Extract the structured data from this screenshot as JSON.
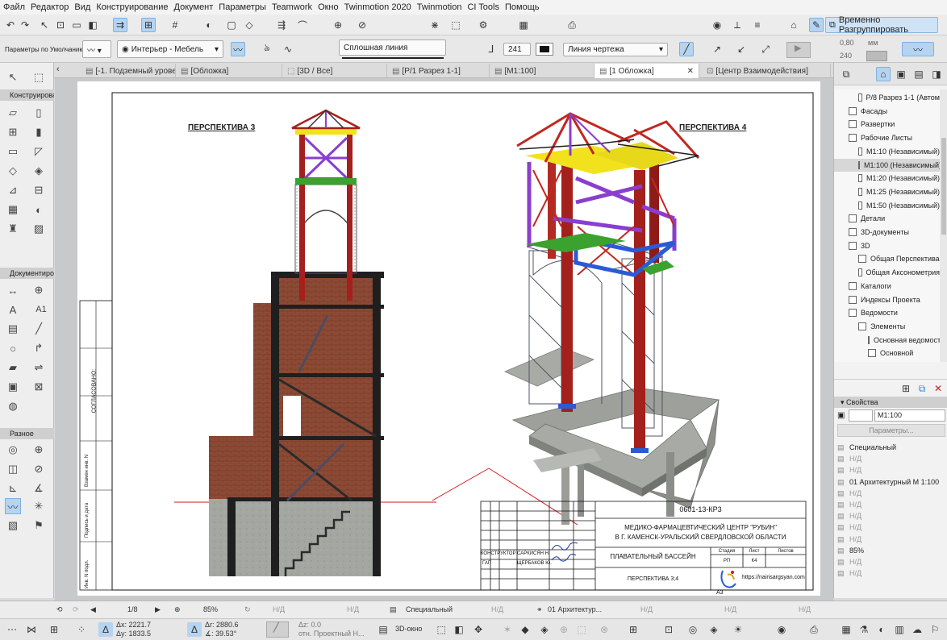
{
  "menu": [
    "Файл",
    "Редактор",
    "Вид",
    "Конструирование",
    "Документ",
    "Параметры",
    "Teamwork",
    "Окно",
    "Twinmotion 2020",
    "Twinmotion",
    "CI Tools",
    "Помощь"
  ],
  "toolbar": {
    "temp_ungroup": "Временно Разгруппировать"
  },
  "infobox": {
    "defaults_label": "Параметры по Умолчанию",
    "interior": "Интерьер - Мебель",
    "line_type": "Сплошная линия",
    "pen_number": "241",
    "line_category": "Линия чертежа",
    "thickness": "0,80",
    "unit": "мм",
    "pen2": "240"
  },
  "tabs": [
    "[-1. Подземный уровень]",
    "[Обложка]",
    "[3D / Все]",
    "[Р/1 Разрез 1-1]",
    "[М1:100]",
    "[1 Обложка]",
    "[Центр Взаимодействия]"
  ],
  "toolbox": {
    "sections": [
      "Конструирова",
      "Документиро",
      "Разное"
    ],
    "text_tool": "A",
    "label_tool": "A1"
  },
  "sheet": {
    "persp3_title": "ПЕРСПЕКТИВА 3",
    "persp4_title": "ПЕРСПЕКТИВА 4",
    "side_stamp": [
      "СОГЛАСОВАНО:",
      "Взамен инв. N",
      "Подпись и дата",
      "Инв. N подл."
    ],
    "title_block": {
      "code": "0601-13-КР3",
      "org_line1": "МЕДИКО-ФАРМАЦЕВТИЧЕСКИЙ ЦЕНТР \"РУБИН\"",
      "org_line2": "В Г. КАМЕНСК-УРАЛЬСКИЙ СВЕРДЛОВСКОЙ ОБЛАСТИ",
      "project": "ПЛАВАТЕЛЬНЫЙ БАССЕЙН",
      "drawing": "ПЕРСПЕКТИВА 3;4",
      "role1": "КОНСТРУКТОР",
      "name1": "САРКИСЯН Н.",
      "role2": "ГАП",
      "name2": "ЩЕРБАКОВ Ю.",
      "stage_label": "Стадия",
      "sheet_label": "Лист",
      "sheets_label": "Листов",
      "stage": "РП",
      "sheet_no": "К4",
      "site": "https://nairisargsyan.com",
      "format": "А3"
    }
  },
  "navigator": {
    "items": [
      {
        "label": "Р/8 Разрез 1-1 (Автом",
        "indent": 2
      },
      {
        "label": "Фасады",
        "indent": 1
      },
      {
        "label": "Развертки",
        "indent": 1
      },
      {
        "label": "Рабочие Листы",
        "indent": 1
      },
      {
        "label": "М1:10 (Независимый)",
        "indent": 2
      },
      {
        "label": "М1:100 (Независимый)",
        "indent": 2
      },
      {
        "label": "М1:20 (Независимый)",
        "indent": 2
      },
      {
        "label": "М1:25 (Независимый)",
        "indent": 2
      },
      {
        "label": "М1:50 (Независимый)",
        "indent": 2
      },
      {
        "label": "Детали",
        "indent": 1
      },
      {
        "label": "3D-документы",
        "indent": 1
      },
      {
        "label": "3D",
        "indent": 1
      },
      {
        "label": "Общая Перспектива",
        "indent": 2
      },
      {
        "label": "Общая Аксонометрия",
        "indent": 2
      },
      {
        "label": "Каталоги",
        "indent": 1
      },
      {
        "label": "Индексы Проекта",
        "indent": 1
      },
      {
        "label": "Ведомости",
        "indent": 1
      },
      {
        "label": "Элементы",
        "indent": 2
      },
      {
        "label": "Основная ведомость",
        "indent": 3
      },
      {
        "label": "Основной",
        "indent": 3
      }
    ],
    "selected": "М1:100 (Независимый)"
  },
  "properties": {
    "header": "Свойства",
    "name_value": "М1:100",
    "params_button": "Параметры...",
    "rows": [
      "Специальный",
      "Н/Д",
      "Н/Д",
      "01 Архитектурный М 1:100",
      "Н/Д",
      "Н/Д",
      "Н/Д",
      "Н/Д",
      "Н/Д",
      "85%",
      "Н/Д",
      "Н/Д"
    ]
  },
  "status": {
    "page": "1/8",
    "zoom": "85%",
    "nd1": "Н/Д",
    "nd2": "Н/Д",
    "layer": "Специальный",
    "nd3": "Н/Д",
    "pen_set": "01 Архитектур...",
    "nd4": "Н/Д",
    "nd5": "Н/Д",
    "nd6": "Н/Д"
  },
  "coords": {
    "dx": "Δx: 2221.7",
    "dy": "Δy: 1833.5",
    "dr": "Δr: 2880.6",
    "angle": "∡: 39.53°",
    "dz": "Δz: 0.0",
    "ref": "отн. Проектный Н...",
    "view3d": "3D-окно"
  },
  "colors": {
    "accent": "#3b87d6",
    "brick": "#8c4a35",
    "steel_red": "#a3201c",
    "purple": "#8a3ecf",
    "yellow": "#f2e21e",
    "green": "#3ba12f",
    "blue": "#2b5ad6",
    "concrete": "#9da09b"
  }
}
